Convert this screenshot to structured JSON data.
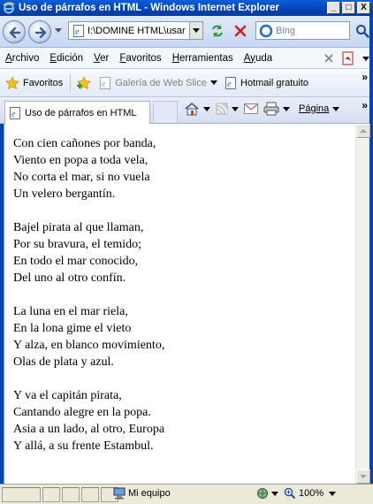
{
  "window": {
    "title": "Uso de párrafos en HTML - Windows Internet Explorer",
    "minimize_glyph": "_",
    "maximize_glyph": "□",
    "close_glyph": "X"
  },
  "address_bar": {
    "url": "I:\\DOMINE HTML\\usar"
  },
  "search": {
    "placeholder": "Bing"
  },
  "menu": {
    "items": [
      {
        "key": "A",
        "rest": "rchivo"
      },
      {
        "key": "E",
        "rest": "dición"
      },
      {
        "key": "V",
        "rest": "er"
      },
      {
        "key": "F",
        "rest": "avoritos"
      },
      {
        "key": "H",
        "rest": "erramientas"
      },
      {
        "key": "Ay",
        "rest": "uda"
      }
    ]
  },
  "favorites_bar": {
    "favorites_label": "Favoritos",
    "web_slice_label": "Galería de Web Slice",
    "hotmail_label": "Hotmail gratuito"
  },
  "tabs": {
    "active_label": "Uso de párrafos en HTML",
    "page_menu_label": "Página"
  },
  "content": {
    "stanzas": [
      [
        "Con cien cañones por banda,",
        "Viento en popa a toda vela,",
        "No corta el mar, si no vuela",
        "Un velero bergantín."
      ],
      [
        "Bajel pirata al que llaman,",
        "Por su bravura, el temido;",
        "En todo el mar conocido,",
        "Del uno al otro confín."
      ],
      [
        "La luna en el mar riela,",
        "En la lona gime el vieto",
        "Y alza, en blanco movimiento,",
        "Olas de plata y azul."
      ],
      [
        "Y va el capitán pirata,",
        "Cantando alegre en la popa.",
        "Asia a un lado, al otro, Europa",
        "Y allá, a su frente Estambul."
      ]
    ]
  },
  "status_bar": {
    "zone": "Mi equipo",
    "zoom": "100%"
  }
}
